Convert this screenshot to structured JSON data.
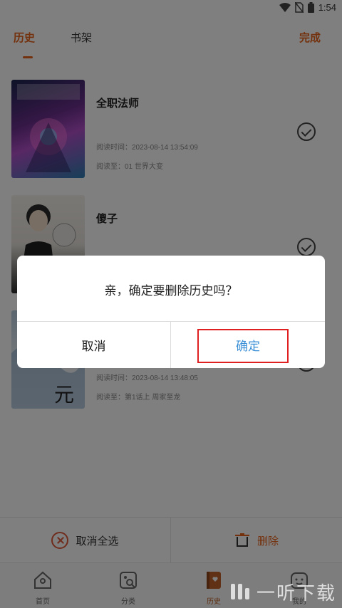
{
  "status_bar": {
    "time": "1:54"
  },
  "header": {
    "tabs": [
      {
        "label": "历史",
        "active": true
      },
      {
        "label": "书架",
        "active": false
      }
    ],
    "done_label": "完成"
  },
  "history": [
    {
      "title": "全职法师",
      "read_time": "阅读时间：2023-08-14 13:54:09",
      "read_to": "阅读至：01 世界大变",
      "checked": true
    },
    {
      "title": "傻子",
      "read_time": "",
      "read_to": "",
      "checked": true
    },
    {
      "title": "",
      "read_time": "阅读时间：2023-08-14 13:48:05",
      "read_to": "阅读至：第1话上 周家至龙",
      "checked": true
    }
  ],
  "actions": {
    "cancel_all_label": "取消全选",
    "delete_label": "删除"
  },
  "nav": {
    "items": [
      {
        "label": "首页",
        "icon": "home-icon",
        "active": false
      },
      {
        "label": "分类",
        "icon": "category-icon",
        "active": false
      },
      {
        "label": "历史",
        "icon": "history-book-icon",
        "active": true
      },
      {
        "label": "我的",
        "icon": "profile-icon",
        "active": false
      }
    ]
  },
  "dialog": {
    "message": "亲，确定要删除历史吗？",
    "cancel_label": "取消",
    "confirm_label": "确定"
  },
  "watermark": {
    "text": "一听下载"
  },
  "colors": {
    "accent": "#e8621a",
    "confirm": "#3a8fd6",
    "highlight": "#e02020"
  }
}
